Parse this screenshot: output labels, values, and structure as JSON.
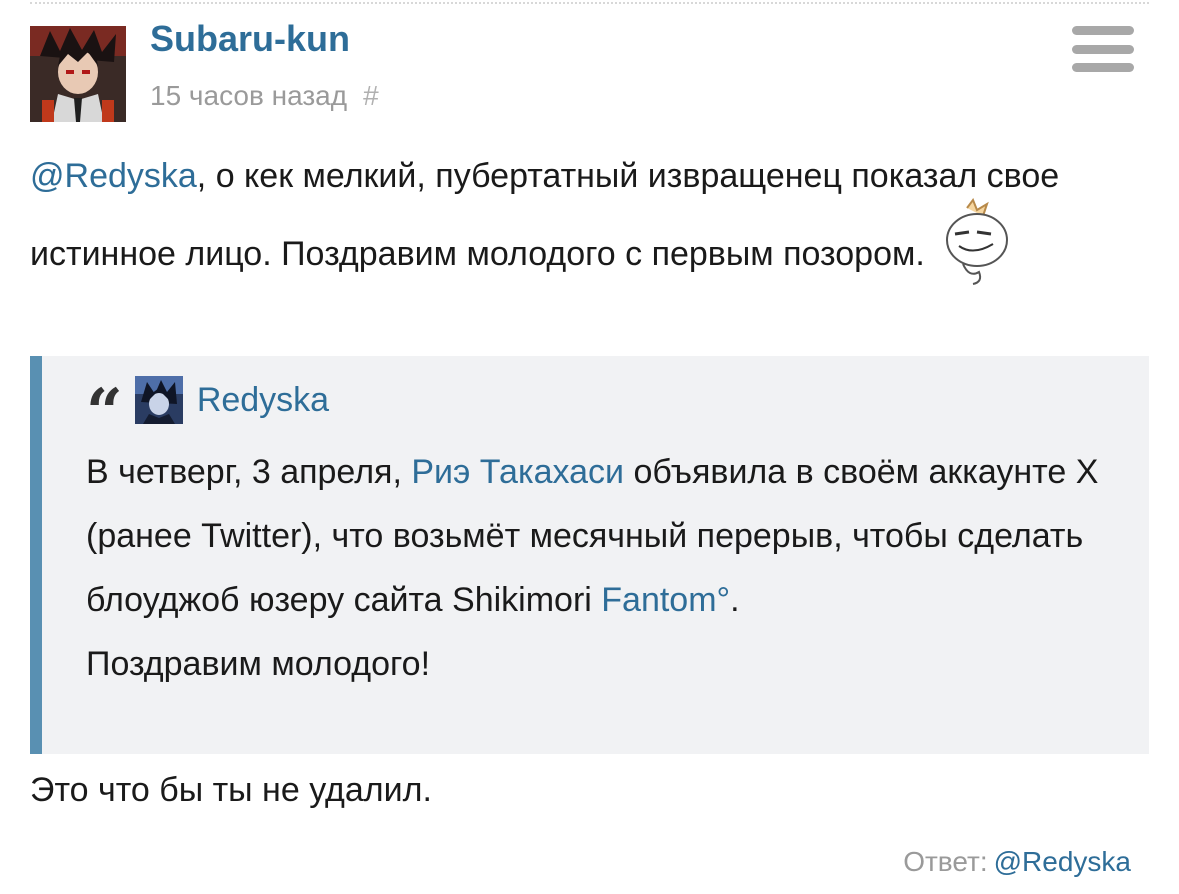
{
  "comment": {
    "author": "Subaru-kun",
    "timestamp": "15 часов назад",
    "hash": "#",
    "body": {
      "mention": "@Redyska",
      "text": ", о кек мелкий, пубертатный извращенец показал свое истинное лицо. Поздравим молодого с первым позором."
    },
    "quote": {
      "author": "Redyska",
      "line1_pre": "В четверг, 3 апреля, ",
      "line1_link": "Риэ Такахаси",
      "line1_post": " объявила в своём аккаунте X (ранее Twitter), что возьмёт месячный перерыв, чтобы сделать блоуджоб юзеру сайта Shikimori ",
      "line1_link2": "Fantom°",
      "line1_end": ".",
      "line2": "Поздравим молодого!"
    },
    "tail": "Это что бы ты не удалил.",
    "reply": {
      "label": "Ответ:",
      "mention": "@Redyska"
    }
  },
  "icons": {
    "menu": "hamburger-icon",
    "smiley": "smirk-smiley-icon",
    "quote": "quote-mark-icon"
  },
  "colors": {
    "link": "#2e6d98",
    "muted": "#9a9a9a",
    "quote_bg": "#f1f2f4",
    "quote_border": "#5990b2"
  }
}
